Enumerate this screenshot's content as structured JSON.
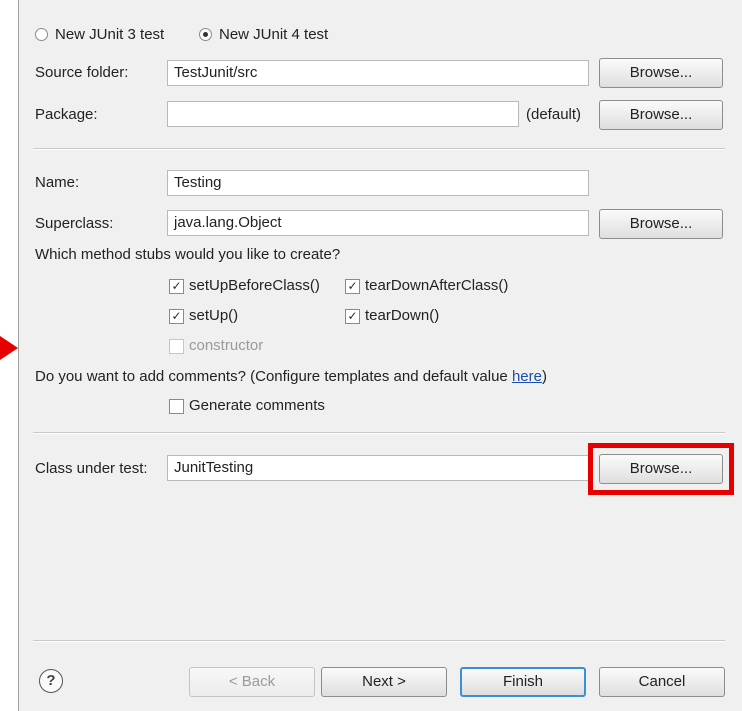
{
  "junit_version": {
    "option3_label": "New JUnit 3 test",
    "option4_label": "New JUnit 4 test",
    "selected": "New JUnit 4 test"
  },
  "source_folder": {
    "label": "Source folder:",
    "value": "TestJunit/src",
    "browse": "Browse..."
  },
  "package": {
    "label": "Package:",
    "value": "",
    "default_hint": "(default)",
    "browse": "Browse..."
  },
  "name": {
    "label": "Name:",
    "value": "Testing"
  },
  "superclass": {
    "label": "Superclass:",
    "value": "java.lang.Object",
    "browse": "Browse..."
  },
  "stubs": {
    "question": "Which method stubs would you like to create?",
    "items": [
      {
        "label": "setUpBeforeClass()",
        "checked": true,
        "enabled": true
      },
      {
        "label": "tearDownAfterClass()",
        "checked": true,
        "enabled": true
      },
      {
        "label": "setUp()",
        "checked": true,
        "enabled": true
      },
      {
        "label": "tearDown()",
        "checked": true,
        "enabled": true
      },
      {
        "label": "constructor",
        "checked": false,
        "enabled": false
      }
    ]
  },
  "comments": {
    "question": "Do you want to add comments? (Configure templates and default value",
    "link": "here",
    "close": ")",
    "generate_label": "Generate comments",
    "generate_checked": false
  },
  "class_under_test": {
    "label": "Class under test:",
    "value": "JunitTesting",
    "browse": "Browse..."
  },
  "footer": {
    "help": "?",
    "back": "< Back",
    "next": "Next >",
    "finish": "Finish",
    "cancel": "Cancel"
  },
  "annotation": {
    "highlight_color": "#e60000",
    "arrow_color": "#e60000"
  }
}
